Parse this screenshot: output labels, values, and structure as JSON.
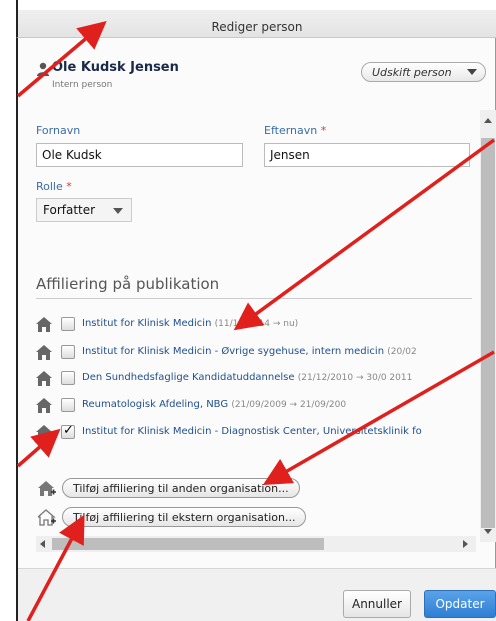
{
  "dialog": {
    "title": "Rediger person"
  },
  "person": {
    "name": "Ole Kudsk Jensen",
    "subtitle": "Intern person",
    "replace_label": "Udskift person"
  },
  "form": {
    "firstname_label": "Fornavn",
    "firstname_value": "Ole Kudsk",
    "lastname_label": "Efternavn",
    "lastname_value": "Jensen",
    "role_label": "Rolle",
    "role_value": "Forfatter",
    "required_mark": "*"
  },
  "affiliations": {
    "title": "Affiliering på publikation",
    "items": [
      {
        "org": "Institut for Klinisk Medicin",
        "date": "(11/11/2014 → nu)",
        "checked": false
      },
      {
        "org": "Institut for Klinisk Medicin - Øvrige sygehuse, intern medicin",
        "date": "(20/02",
        "checked": false
      },
      {
        "org": "Den Sundhedsfaglige Kandidatuddannelse",
        "date": "(21/12/2010 → 30/0 2011",
        "checked": false
      },
      {
        "org": "Reumatologisk Afdeling, NBG",
        "date": "(21/09/2009 → 21/09/200",
        "checked": false
      },
      {
        "org": "Institut for Klinisk Medicin - Diagnostisk Center, Universitetsklinik fo",
        "date": "",
        "checked": true
      }
    ],
    "add_other_label": "Tilføj affiliering til anden organisation...",
    "add_external_label": "Tilføj affiliering til ekstern organisation..."
  },
  "footer": {
    "cancel_label": "Annuller",
    "update_label": "Opdater"
  },
  "colors": {
    "link": "#1f4f8f",
    "primary": "#2f7ed3",
    "annotation_arrow": "#e0201c",
    "required": "#d33333"
  },
  "icons": [
    "person-icon",
    "home-icon",
    "home-add-icon",
    "home-external-add-icon",
    "checkbox-icon"
  ]
}
